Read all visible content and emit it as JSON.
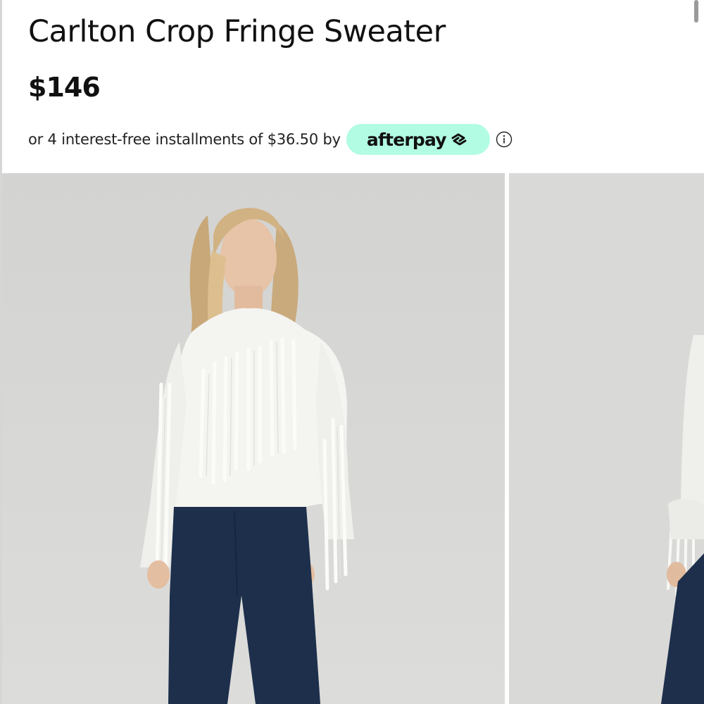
{
  "product": {
    "title": "Carlton Crop Fringe Sweater",
    "price": "$146"
  },
  "payment": {
    "installments_text": "or 4 interest-free installments of $36.50 by",
    "provider_name": "afterpay",
    "provider_logo_icon": "afterpay-arrows-icon",
    "info_icon": "info-circle-icon",
    "badge_color": "#b2fce4"
  },
  "gallery": {
    "slides": [
      {
        "description_icon": "model-photo-front"
      },
      {
        "description_icon": "model-photo-side"
      }
    ],
    "background_color": "#d8d8d6"
  }
}
